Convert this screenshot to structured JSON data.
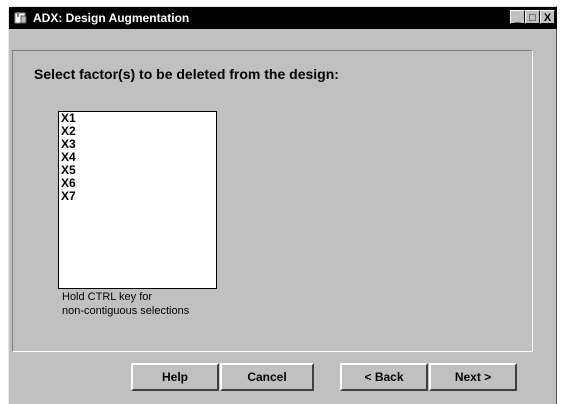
{
  "window": {
    "title": "ADX: Design Augmentation",
    "controls": {
      "minimize": "_",
      "maximize": "□",
      "close": "X"
    }
  },
  "heading": "Select factor(s) to be deleted from the design:",
  "factors": [
    "X1",
    "X2",
    "X3",
    "X4",
    "X5",
    "X6",
    "X7"
  ],
  "hint": {
    "line1": "Hold CTRL key for",
    "line2": "non-contiguous selections"
  },
  "buttons": {
    "help": "Help",
    "cancel": "Cancel",
    "back": "< Back",
    "next": "Next >"
  }
}
